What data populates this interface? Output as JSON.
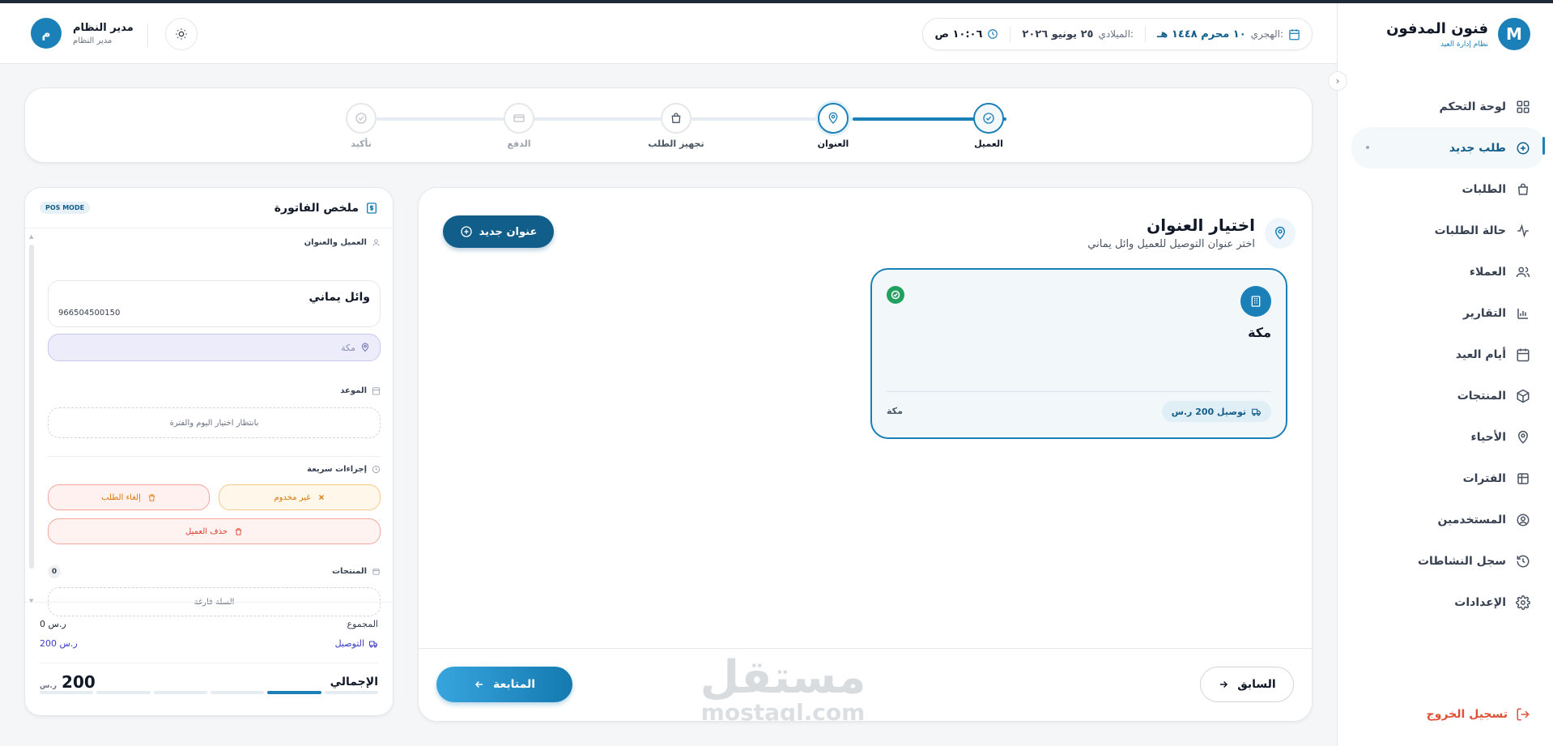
{
  "brand": {
    "logo_letter": "M",
    "title": "فنون المدفون",
    "subtitle": "نظام إدارة العيد"
  },
  "nav": [
    {
      "label": "لوحة التحكم",
      "icon": "dashboard-icon"
    },
    {
      "label": "طلب جديد",
      "icon": "plus-circle-icon",
      "active": true
    },
    {
      "label": "الطلبات",
      "icon": "bag-icon"
    },
    {
      "label": "حالة الطلبات",
      "icon": "activity-icon"
    },
    {
      "label": "العملاء",
      "icon": "users-icon"
    },
    {
      "label": "التقارير",
      "icon": "chart-icon"
    },
    {
      "label": "أيام العيد",
      "icon": "calendar-icon"
    },
    {
      "label": "المنتجات",
      "icon": "box-icon"
    },
    {
      "label": "الأحياء",
      "icon": "map-pin-icon"
    },
    {
      "label": "الفترات",
      "icon": "clock-icon"
    },
    {
      "label": "المستخدمين",
      "icon": "user-circle-icon"
    },
    {
      "label": "سجل النشاطات",
      "icon": "history-icon"
    },
    {
      "label": "الإعدادات",
      "icon": "gear-icon"
    }
  ],
  "logout_label": "تسجيل الخروج",
  "header": {
    "hijri_label": "الهجري:",
    "hijri_value": "١٠ محرم ١٤٤٨ هـ",
    "greg_label": "الميلادي:",
    "greg_value": "٢٥ يونيو ٢٠٢٦",
    "time_value": "١٠:٠٦ ص",
    "user_name": "مدير النظام",
    "user_role": "مدير النظام",
    "avatar_letter": "م"
  },
  "steps": [
    {
      "label": "العميل",
      "state": "done"
    },
    {
      "label": "العنوان",
      "state": "current"
    },
    {
      "label": "تجهيز الطلب",
      "state": "next"
    },
    {
      "label": "الدفع",
      "state": "todo"
    },
    {
      "label": "تأكيد",
      "state": "todo"
    }
  ],
  "main": {
    "title": "اختيار العنوان",
    "subtitle": "اختر عنوان التوصيل للعميل وائل يماني",
    "new_address_label": "عنوان جديد",
    "address": {
      "name": "مكة",
      "city": "مكة",
      "delivery": "توصيل 200 ر.س"
    },
    "next_label": "المتابعة",
    "prev_label": "السابق",
    "watermark_ar": "مستقل",
    "watermark_en": "mostaql.com"
  },
  "invoice": {
    "title": "ملخص الفاتورة",
    "mode": "POS MODE",
    "customer_section": "العميل والعنوان",
    "customer_name": "وائل يماني",
    "customer_phone": "966504500150",
    "address_placeholder": "مكة",
    "appointment_section": "الموعد",
    "appointment_text": "بانتظار اختيار اليوم والفترة",
    "quick_section": "إجراءات سريعة",
    "btn_unserved": "غير مخدوم",
    "btn_cancel": "إلغاء الطلب",
    "btn_delete": "حذف العميل",
    "products_section": "المنتجات",
    "products_count": "0",
    "cart_empty": "السلة فارغة",
    "subtotal_label": "المجموع",
    "subtotal_value": "0 ر.س",
    "delivery_label": "التوصيل",
    "delivery_value": "200 ر.س",
    "total_label": "الإجمالي",
    "total_value": "200",
    "total_currency": "ر.س",
    "progress_steps": 6,
    "progress_active": 2
  },
  "colors": {
    "primary": "#1b7fb8",
    "primary_dark": "#125e8a",
    "success": "#22a060",
    "danger": "#dc3d2b",
    "warning": "#d97706"
  }
}
